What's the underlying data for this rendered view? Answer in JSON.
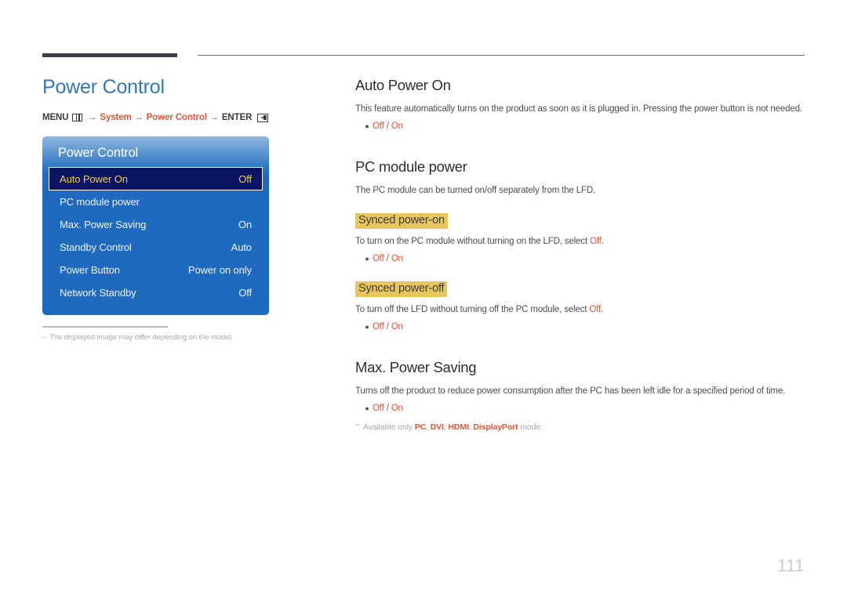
{
  "header": {
    "rule_thick": "",
    "rule_thin": ""
  },
  "left": {
    "page_title": "Power Control",
    "breadcrumb": {
      "menu_label": "MENU",
      "menu_icon": "menu-grid-icon",
      "arrow": "→",
      "item1": "System",
      "item2": "Power Control",
      "enter_label": "ENTER",
      "enter_icon": "enter-key-icon"
    },
    "osd": {
      "title": "Power Control",
      "rows": [
        {
          "label": "Auto Power On",
          "value": "Off",
          "selected": true
        },
        {
          "label": "PC module power",
          "value": "",
          "selected": false
        },
        {
          "label": "Max. Power Saving",
          "value": "On",
          "selected": false
        },
        {
          "label": "Standby Control",
          "value": "Auto",
          "selected": false
        },
        {
          "label": "Power Button",
          "value": "Power on only",
          "selected": false
        },
        {
          "label": "Network Standby",
          "value": "Off",
          "selected": false
        }
      ]
    },
    "footnote": {
      "dash": "–",
      "text": "The displayed image may differ depending on the model."
    }
  },
  "right": {
    "s1": {
      "heading": "Auto Power On",
      "body": "This feature automatically turns on the product as soon as it is plugged in. Pressing the power button is not needed.",
      "option_off": "Off",
      "option_slash": " / ",
      "option_on": "On"
    },
    "s2": {
      "heading": "PC module power",
      "body": "The PC module can be turned on/off separately from the LFD.",
      "sub1": {
        "highlight": "Synced power-on",
        "body_pre": "To turn on the PC module without turning on the LFD, select ",
        "body_accent": "Off",
        "body_post": ".",
        "option_off": "Off",
        "option_slash": " / ",
        "option_on": "On"
      },
      "sub2": {
        "highlight": "Synced power-off",
        "body_pre": "To turn off the LFD without turning off the PC module, select ",
        "body_accent": "Off",
        "body_post": ".",
        "option_off": "Off",
        "option_slash": " / ",
        "option_on": "On"
      }
    },
    "s3": {
      "heading": "Max. Power Saving",
      "body": "Turns off the product to reduce power consumption after the PC has been left idle for a specified period of time.",
      "option_off": "Off",
      "option_slash": " / ",
      "option_on": "On",
      "note": {
        "dash": "–",
        "pre": "Available only ",
        "m1": "PC",
        "sep1": ", ",
        "m2": "DVI",
        "sep2": ", ",
        "m3": "HDMI",
        "sep3": ", ",
        "m4": "DisplayPort",
        "post": " mode."
      }
    }
  },
  "page_number": "111",
  "colors": {
    "title_blue": "#2f77bc",
    "accent_orange": "#e2573b",
    "highlight_gold": "#e8c65c",
    "osd_blue": "#1f69be",
    "osd_selected": "#0b1564",
    "osd_selected_text": "#f2c84b"
  }
}
